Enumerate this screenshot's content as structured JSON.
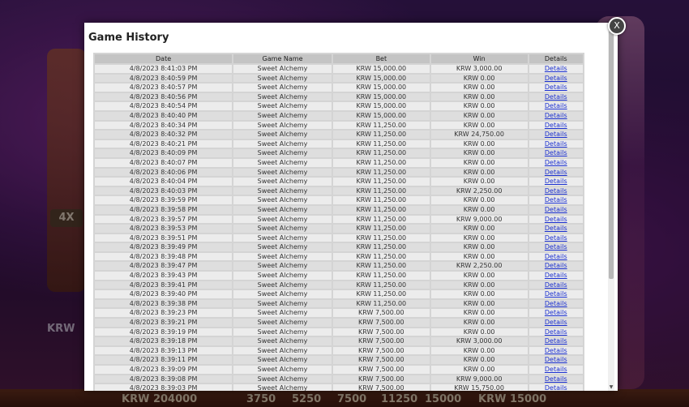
{
  "background": {
    "multiplier": "4X",
    "left_currency": "KRW",
    "bottom_values": [
      "KRW 204000",
      "3750",
      "5250",
      "7500",
      "11250",
      "15000",
      "KRW 15000"
    ]
  },
  "modal": {
    "title": "Game History",
    "close_label": "X"
  },
  "table": {
    "headers": [
      "Date",
      "Game Name",
      "Bet",
      "Win",
      "Details"
    ],
    "rows": [
      [
        "4/8/2023 8:41:03 PM",
        "Sweet Alchemy",
        "KRW 15,000.00",
        "KRW 3,000.00",
        "Details"
      ],
      [
        "4/8/2023 8:40:59 PM",
        "Sweet Alchemy",
        "KRW 15,000.00",
        "KRW 0.00",
        "Details"
      ],
      [
        "4/8/2023 8:40:57 PM",
        "Sweet Alchemy",
        "KRW 15,000.00",
        "KRW 0.00",
        "Details"
      ],
      [
        "4/8/2023 8:40:56 PM",
        "Sweet Alchemy",
        "KRW 15,000.00",
        "KRW 0.00",
        "Details"
      ],
      [
        "4/8/2023 8:40:54 PM",
        "Sweet Alchemy",
        "KRW 15,000.00",
        "KRW 0.00",
        "Details"
      ],
      [
        "4/8/2023 8:40:40 PM",
        "Sweet Alchemy",
        "KRW 15,000.00",
        "KRW 0.00",
        "Details"
      ],
      [
        "4/8/2023 8:40:34 PM",
        "Sweet Alchemy",
        "KRW 11,250.00",
        "KRW 0.00",
        "Details"
      ],
      [
        "4/8/2023 8:40:32 PM",
        "Sweet Alchemy",
        "KRW 11,250.00",
        "KRW 24,750.00",
        "Details"
      ],
      [
        "4/8/2023 8:40:21 PM",
        "Sweet Alchemy",
        "KRW 11,250.00",
        "KRW 0.00",
        "Details"
      ],
      [
        "4/8/2023 8:40:09 PM",
        "Sweet Alchemy",
        "KRW 11,250.00",
        "KRW 0.00",
        "Details"
      ],
      [
        "4/8/2023 8:40:07 PM",
        "Sweet Alchemy",
        "KRW 11,250.00",
        "KRW 0.00",
        "Details"
      ],
      [
        "4/8/2023 8:40:06 PM",
        "Sweet Alchemy",
        "KRW 11,250.00",
        "KRW 0.00",
        "Details"
      ],
      [
        "4/8/2023 8:40:04 PM",
        "Sweet Alchemy",
        "KRW 11,250.00",
        "KRW 0.00",
        "Details"
      ],
      [
        "4/8/2023 8:40:03 PM",
        "Sweet Alchemy",
        "KRW 11,250.00",
        "KRW 2,250.00",
        "Details"
      ],
      [
        "4/8/2023 8:39:59 PM",
        "Sweet Alchemy",
        "KRW 11,250.00",
        "KRW 0.00",
        "Details"
      ],
      [
        "4/8/2023 8:39:58 PM",
        "Sweet Alchemy",
        "KRW 11,250.00",
        "KRW 0.00",
        "Details"
      ],
      [
        "4/8/2023 8:39:57 PM",
        "Sweet Alchemy",
        "KRW 11,250.00",
        "KRW 9,000.00",
        "Details"
      ],
      [
        "4/8/2023 8:39:53 PM",
        "Sweet Alchemy",
        "KRW 11,250.00",
        "KRW 0.00",
        "Details"
      ],
      [
        "4/8/2023 8:39:51 PM",
        "Sweet Alchemy",
        "KRW 11,250.00",
        "KRW 0.00",
        "Details"
      ],
      [
        "4/8/2023 8:39:49 PM",
        "Sweet Alchemy",
        "KRW 11,250.00",
        "KRW 0.00",
        "Details"
      ],
      [
        "4/8/2023 8:39:48 PM",
        "Sweet Alchemy",
        "KRW 11,250.00",
        "KRW 0.00",
        "Details"
      ],
      [
        "4/8/2023 8:39:47 PM",
        "Sweet Alchemy",
        "KRW 11,250.00",
        "KRW 2,250.00",
        "Details"
      ],
      [
        "4/8/2023 8:39:43 PM",
        "Sweet Alchemy",
        "KRW 11,250.00",
        "KRW 0.00",
        "Details"
      ],
      [
        "4/8/2023 8:39:41 PM",
        "Sweet Alchemy",
        "KRW 11,250.00",
        "KRW 0.00",
        "Details"
      ],
      [
        "4/8/2023 8:39:40 PM",
        "Sweet Alchemy",
        "KRW 11,250.00",
        "KRW 0.00",
        "Details"
      ],
      [
        "4/8/2023 8:39:38 PM",
        "Sweet Alchemy",
        "KRW 11,250.00",
        "KRW 0.00",
        "Details"
      ],
      [
        "4/8/2023 8:39:23 PM",
        "Sweet Alchemy",
        "KRW 7,500.00",
        "KRW 0.00",
        "Details"
      ],
      [
        "4/8/2023 8:39:21 PM",
        "Sweet Alchemy",
        "KRW 7,500.00",
        "KRW 0.00",
        "Details"
      ],
      [
        "4/8/2023 8:39:19 PM",
        "Sweet Alchemy",
        "KRW 7,500.00",
        "KRW 0.00",
        "Details"
      ],
      [
        "4/8/2023 8:39:18 PM",
        "Sweet Alchemy",
        "KRW 7,500.00",
        "KRW 3,000.00",
        "Details"
      ],
      [
        "4/8/2023 8:39:13 PM",
        "Sweet Alchemy",
        "KRW 7,500.00",
        "KRW 0.00",
        "Details"
      ],
      [
        "4/8/2023 8:39:11 PM",
        "Sweet Alchemy",
        "KRW 7,500.00",
        "KRW 0.00",
        "Details"
      ],
      [
        "4/8/2023 8:39:09 PM",
        "Sweet Alchemy",
        "KRW 7,500.00",
        "KRW 0.00",
        "Details"
      ],
      [
        "4/8/2023 8:39:08 PM",
        "Sweet Alchemy",
        "KRW 7,500.00",
        "KRW 9,000.00",
        "Details"
      ],
      [
        "4/8/2023 8:39:03 PM",
        "Sweet Alchemy",
        "KRW 7,500.00",
        "KRW 15,750.00",
        "Details"
      ]
    ]
  }
}
